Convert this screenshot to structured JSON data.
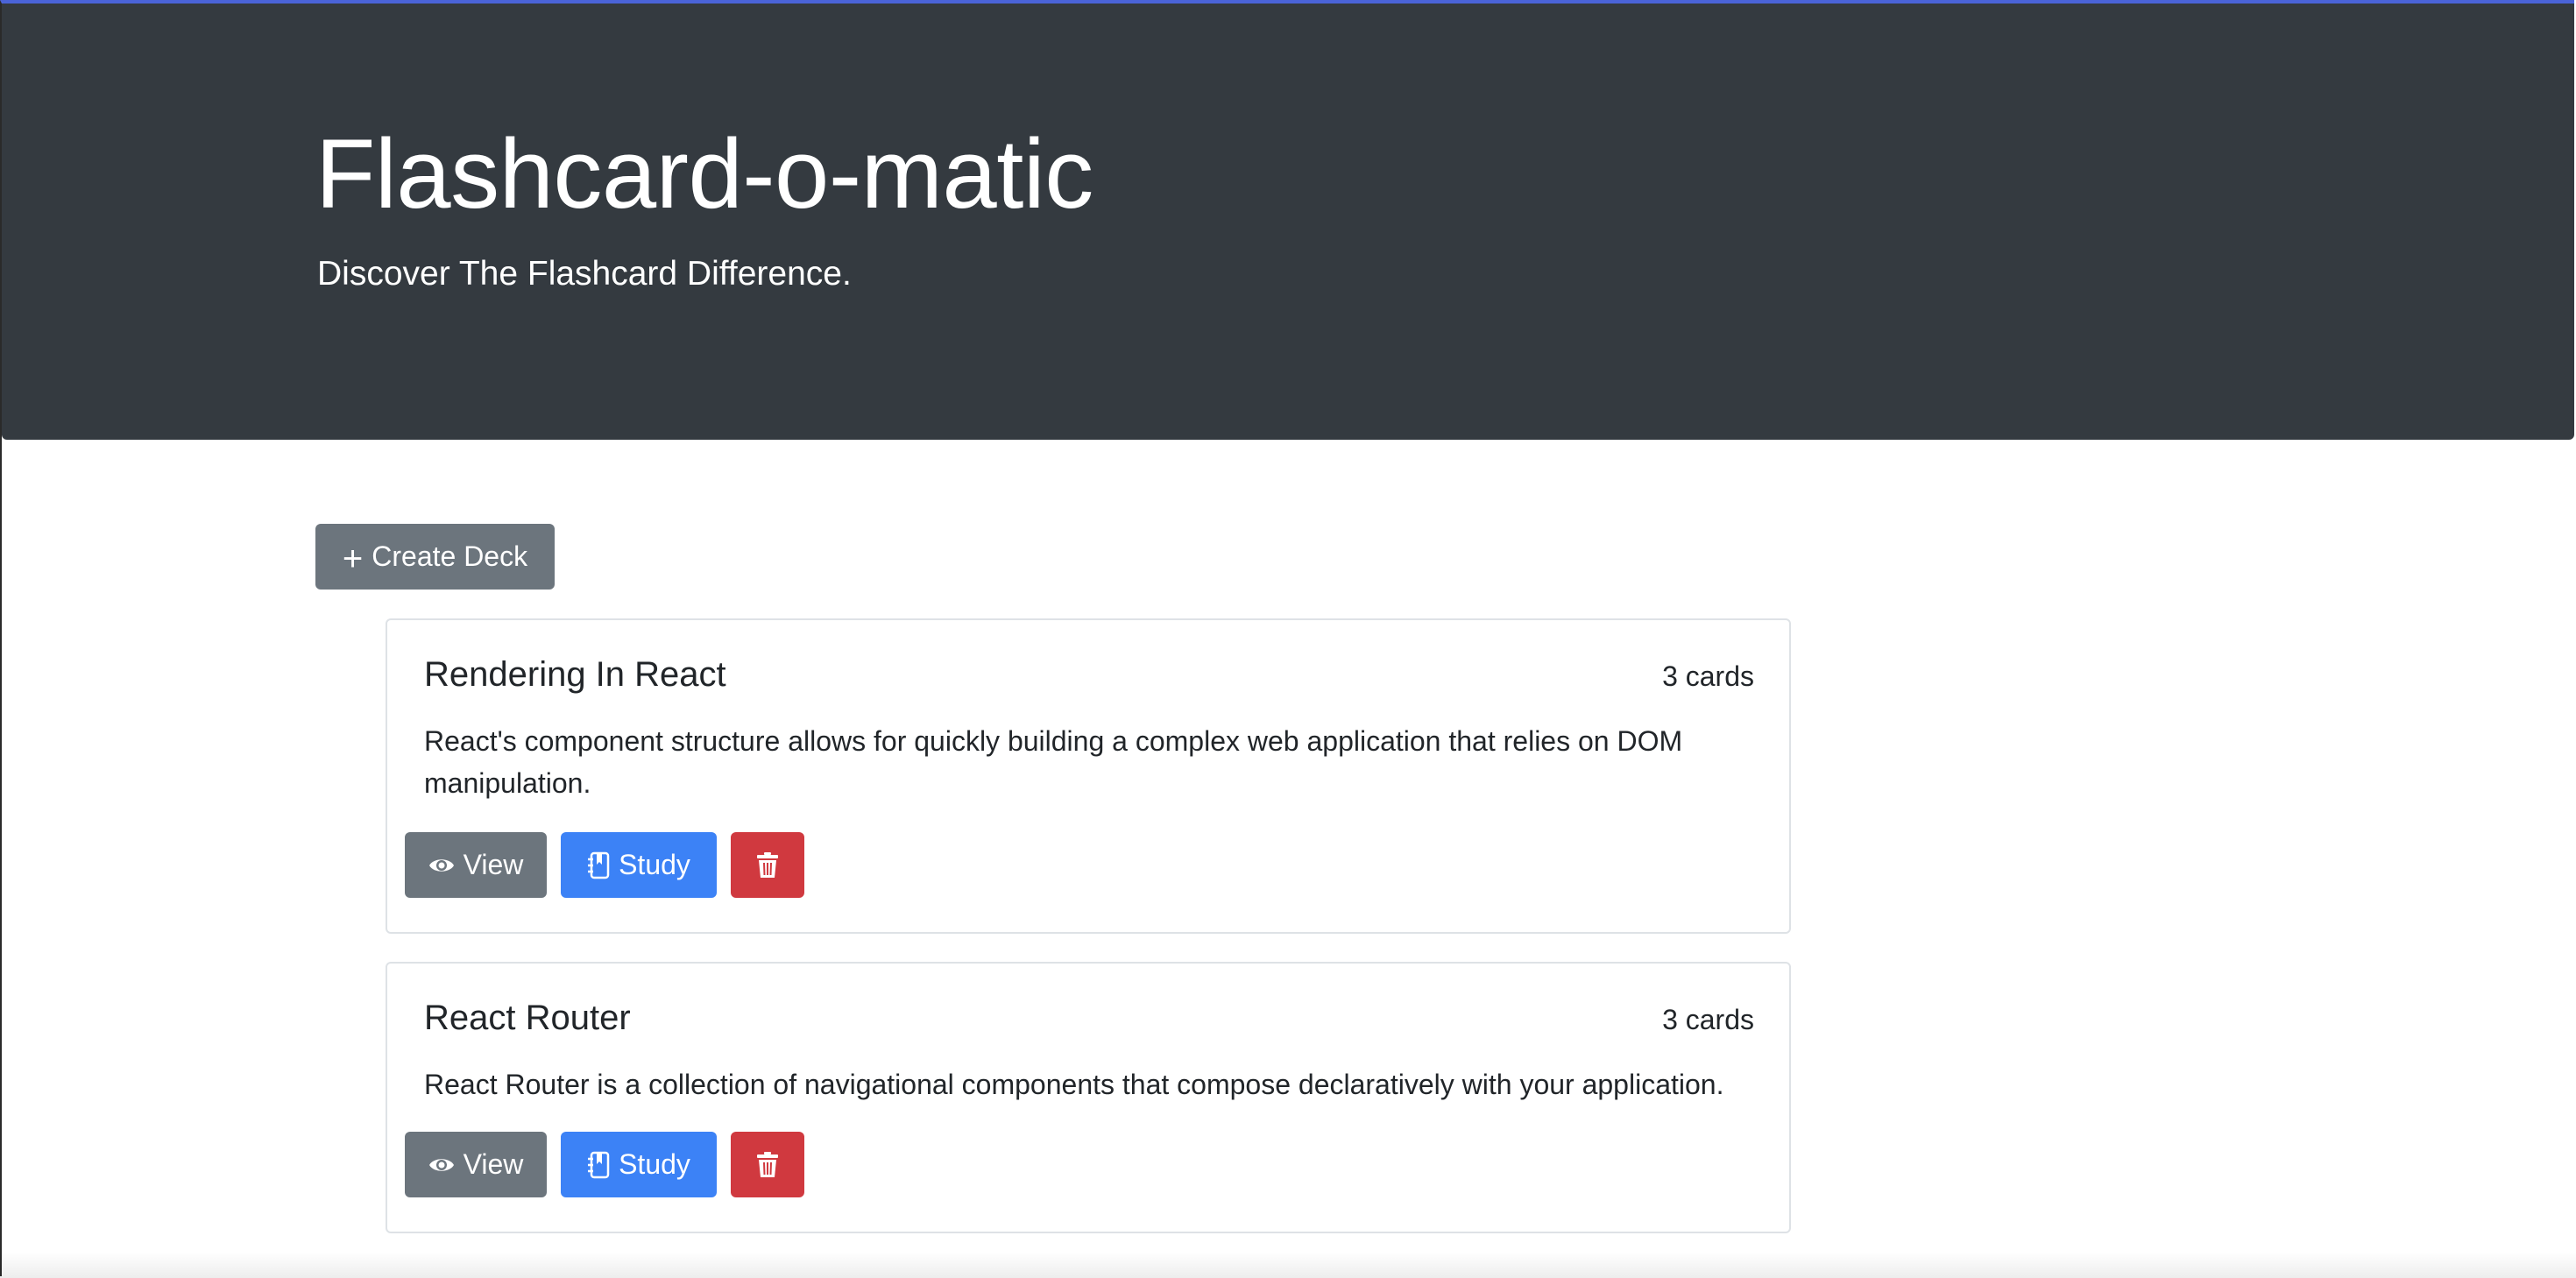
{
  "header": {
    "title": "Flashcard-o-matic",
    "subtitle": "Discover The Flashcard Difference."
  },
  "actions": {
    "create_label": "Create Deck",
    "create_icon": "plus-icon"
  },
  "decks": [
    {
      "name": "Rendering In React",
      "count": "3 cards",
      "description": "React's component structure allows for quickly building a complex web application that relies on DOM manipulation.",
      "view_label": "View",
      "study_label": "Study"
    },
    {
      "name": "React Router",
      "count": "3 cards",
      "description": "React Router is a collection of navigational components that compose declaratively with your application.",
      "view_label": "View",
      "study_label": "Study"
    }
  ],
  "icons": {
    "view": "eye-icon",
    "study": "journal-bookmark-icon",
    "delete": "trash-icon"
  },
  "colors": {
    "header_bg": "#343a40",
    "secondary": "#6c757d",
    "primary": "#3c82f6",
    "danger": "#d0393f"
  }
}
